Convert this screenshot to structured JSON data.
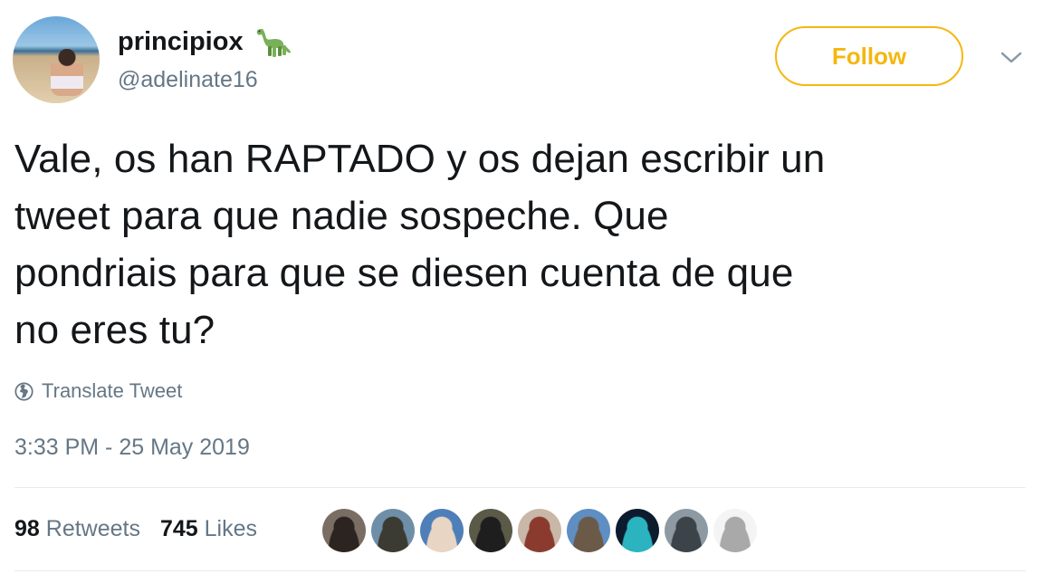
{
  "user": {
    "display_name": "principiox",
    "name_emoji": "sauropod-dinosaur",
    "handle": "@adelinate16"
  },
  "follow_button": {
    "label": "Follow",
    "color": "#f5b70f"
  },
  "tweet": {
    "text": "Vale, os han RAPTADO y os dejan escribir un\ntweet para que nadie sospeche. Que\npondriais para que se diesen cuenta de que\nno eres tu?",
    "translate_label": "Translate Tweet",
    "timestamp": "3:33 PM - 25 May 2019"
  },
  "stats": {
    "retweets_count": "98",
    "retweets_label": "Retweets",
    "likes_count": "745",
    "likes_label": "Likes"
  },
  "likers": [
    {
      "name": "liker-1",
      "bg": "#7a6e62",
      "fg": "#2b2420"
    },
    {
      "name": "liker-2",
      "bg": "#6f8fa8",
      "fg": "#3b3a33"
    },
    {
      "name": "liker-3",
      "bg": "#4f7fb8",
      "fg": "#e8d5c4"
    },
    {
      "name": "liker-4",
      "bg": "#5b5a48",
      "fg": "#1e1e1e"
    },
    {
      "name": "liker-5",
      "bg": "#c9b7a8",
      "fg": "#8a3b2e"
    },
    {
      "name": "liker-6",
      "bg": "#5e8ec2",
      "fg": "#6c5a48"
    },
    {
      "name": "liker-7",
      "bg": "#0d1b2e",
      "fg": "#2bb3c0"
    },
    {
      "name": "liker-8",
      "bg": "#8e9aa3",
      "fg": "#3d4449"
    },
    {
      "name": "liker-9",
      "bg": "#f4f4f4",
      "fg": "#a9a9a9"
    }
  ],
  "colors": {
    "text_primary": "#14171a",
    "text_secondary": "#657786",
    "divider": "#e6ecf0"
  }
}
